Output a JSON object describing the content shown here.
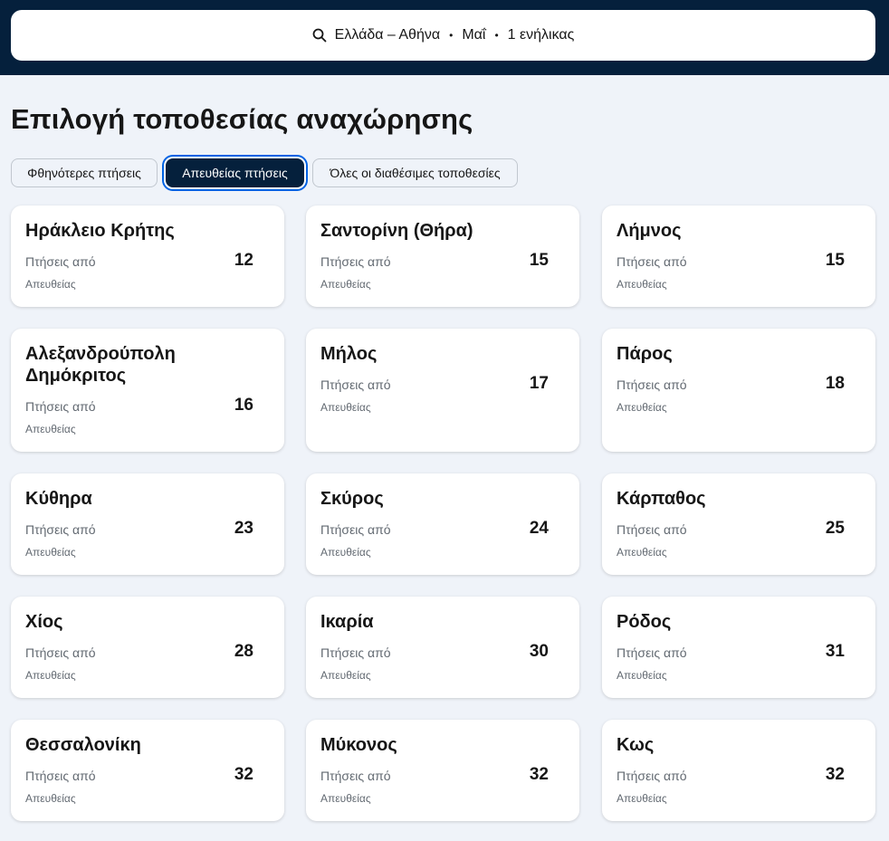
{
  "search": {
    "destination": "Ελλάδα – Αθήνα",
    "month": "Μαΐ",
    "travellers": "1 ενήλικας",
    "separator": "•"
  },
  "page_title": "Επιλογή τοποθεσίας αναχώρησης",
  "tabs": [
    {
      "label": "Φθηνότερες πτήσεις",
      "active": false
    },
    {
      "label": "Απευθείας πτήσεις",
      "active": true
    },
    {
      "label": "Όλες οι διαθέσιμες τοποθεσίες",
      "active": false
    }
  ],
  "cards": [
    {
      "city": "Ηράκλειο Κρήτης",
      "from_label": "Πτήσεις από",
      "price": "12",
      "direct": "Απευθείας"
    },
    {
      "city": "Σαντορίνη (Θήρα)",
      "from_label": "Πτήσεις από",
      "price": "15",
      "direct": "Απευθείας"
    },
    {
      "city": "Λήμνος",
      "from_label": "Πτήσεις από",
      "price": "15",
      "direct": "Απευθείας"
    },
    {
      "city": "Αλεξανδρούπολη Δημόκριτος",
      "from_label": "Πτήσεις από",
      "price": "16",
      "direct": "Απευθείας"
    },
    {
      "city": "Μήλος",
      "from_label": "Πτήσεις από",
      "price": "17",
      "direct": "Απευθείας"
    },
    {
      "city": "Πάρος",
      "from_label": "Πτήσεις από",
      "price": "18",
      "direct": "Απευθείας"
    },
    {
      "city": "Κύθηρα",
      "from_label": "Πτήσεις από",
      "price": "23",
      "direct": "Απευθείας"
    },
    {
      "city": "Σκύρος",
      "from_label": "Πτήσεις από",
      "price": "24",
      "direct": "Απευθείας"
    },
    {
      "city": "Κάρπαθος",
      "from_label": "Πτήσεις από",
      "price": "25",
      "direct": "Απευθείας"
    },
    {
      "city": "Χίος",
      "from_label": "Πτήσεις από",
      "price": "28",
      "direct": "Απευθείας"
    },
    {
      "city": "Ικαρία",
      "from_label": "Πτήσεις από",
      "price": "30",
      "direct": "Απευθείας"
    },
    {
      "city": "Ρόδος",
      "from_label": "Πτήσεις από",
      "price": "31",
      "direct": "Απευθείας"
    },
    {
      "city": "Θεσσαλονίκη",
      "from_label": "Πτήσεις από",
      "price": "32",
      "direct": "Απευθείας"
    },
    {
      "city": "Μύκονος",
      "from_label": "Πτήσεις από",
      "price": "32",
      "direct": "Απευθείας"
    },
    {
      "city": "Κως",
      "from_label": "Πτήσεις από",
      "price": "32",
      "direct": "Απευθείας"
    }
  ]
}
